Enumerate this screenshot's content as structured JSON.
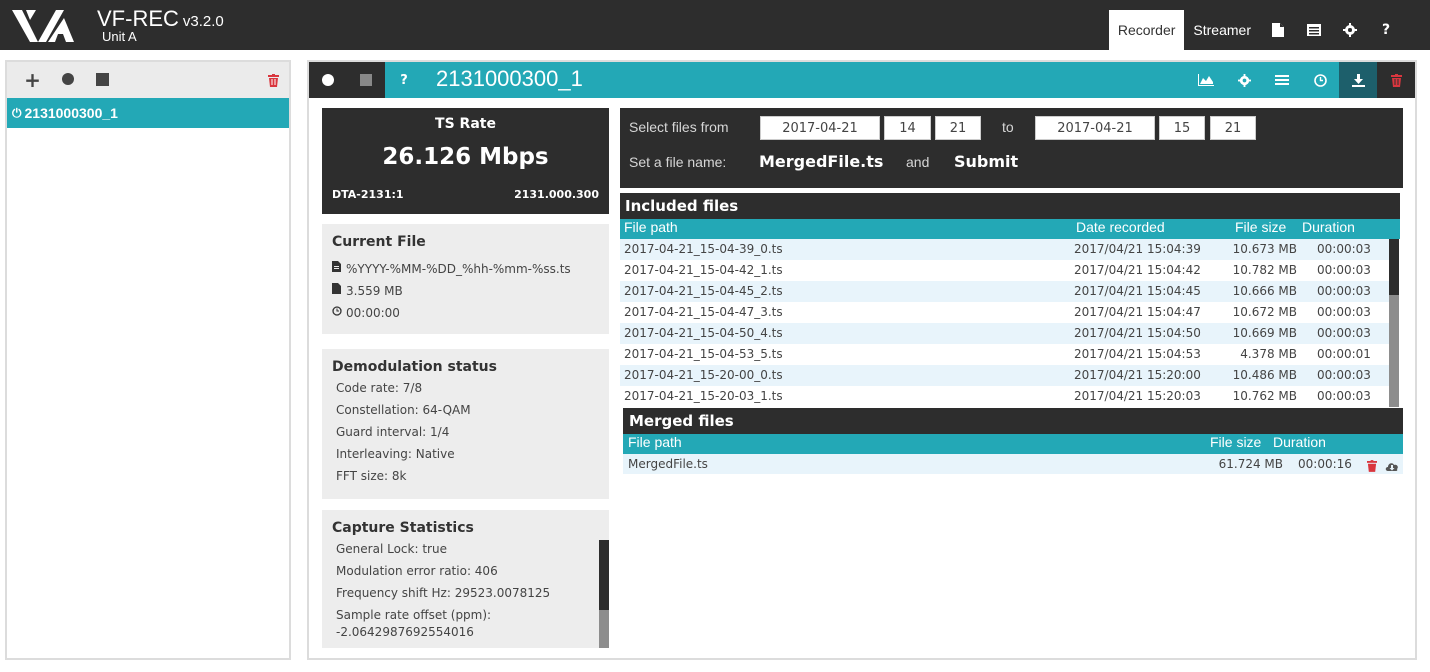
{
  "app": {
    "name": "VF-REC",
    "version": "v3.2.0",
    "unit": "Unit A"
  },
  "top_nav": {
    "tabs": [
      {
        "label": "Recorder",
        "active": true
      },
      {
        "label": "Streamer",
        "active": false
      }
    ],
    "icons": [
      "file-icon",
      "list-icon",
      "gear-icon",
      "help-icon"
    ]
  },
  "left_panel": {
    "toolbar_icons": [
      "add-icon",
      "record-icon",
      "stop-icon",
      "trash-icon"
    ],
    "recordings": [
      {
        "name": "2131000300_1",
        "selected": true
      }
    ]
  },
  "main": {
    "title": "2131000300_1",
    "help_label": "?",
    "header_icons": [
      "chart-icon",
      "gear-icon",
      "list-icon",
      "clock-icon",
      "download-icon",
      "trash-icon"
    ],
    "ts_rate": {
      "label": "TS Rate",
      "value": "26.126 Mbps",
      "device": "DTA-2131:1",
      "frequency": "2131.000.300"
    },
    "current_file": {
      "title": "Current File",
      "pattern": "%YYYY-%MM-%DD_%hh-%mm-%ss.ts",
      "size": "3.559 MB",
      "duration": "00:00:00"
    },
    "demodulation": {
      "title": "Demodulation status",
      "rows": [
        "Code rate: 7/8",
        "Constellation: 64-QAM",
        "Guard interval: 1/4",
        "Interleaving: Native",
        "FFT size: 8k"
      ]
    },
    "capture": {
      "title": "Capture Statistics",
      "rows": [
        "General Lock: true",
        "Modulation error ratio: 406",
        "Frequency shift Hz: 29523.0078125",
        "Sample rate offset (ppm):",
        "-2.0642987692554016"
      ]
    },
    "select": {
      "from_label": "Select files from",
      "from_date": "2017-04-21",
      "from_hour": "14",
      "from_min": "21",
      "to_label": "to",
      "to_date": "2017-04-21",
      "to_hour": "15",
      "to_min": "21",
      "name_label": "Set a file name:",
      "file_name": "MergedFile.ts",
      "and_label": "and",
      "submit_label": "Submit"
    },
    "included": {
      "title": "Included files",
      "columns": [
        "File path",
        "Date recorded",
        "File size",
        "Duration"
      ],
      "rows": [
        [
          "2017-04-21_15-04-39_0.ts",
          "2017/04/21 15:04:39",
          "10.673 MB",
          "00:00:03"
        ],
        [
          "2017-04-21_15-04-42_1.ts",
          "2017/04/21 15:04:42",
          "10.782 MB",
          "00:00:03"
        ],
        [
          "2017-04-21_15-04-45_2.ts",
          "2017/04/21 15:04:45",
          "10.666 MB",
          "00:00:03"
        ],
        [
          "2017-04-21_15-04-47_3.ts",
          "2017/04/21 15:04:47",
          "10.672 MB",
          "00:00:03"
        ],
        [
          "2017-04-21_15-04-50_4.ts",
          "2017/04/21 15:04:50",
          "10.669 MB",
          "00:00:03"
        ],
        [
          "2017-04-21_15-04-53_5.ts",
          "2017/04/21 15:04:53",
          "4.378 MB",
          "00:00:01"
        ],
        [
          "2017-04-21_15-20-00_0.ts",
          "2017/04/21 15:20:00",
          "10.486 MB",
          "00:00:03"
        ],
        [
          "2017-04-21_15-20-03_1.ts",
          "2017/04/21 15:20:03",
          "10.762 MB",
          "00:00:03"
        ]
      ]
    },
    "merged": {
      "title": "Merged files",
      "columns": [
        "File path",
        "File size",
        "Duration"
      ],
      "rows": [
        [
          "MergedFile.ts",
          "61.724 MB",
          "00:00:16"
        ]
      ]
    }
  }
}
